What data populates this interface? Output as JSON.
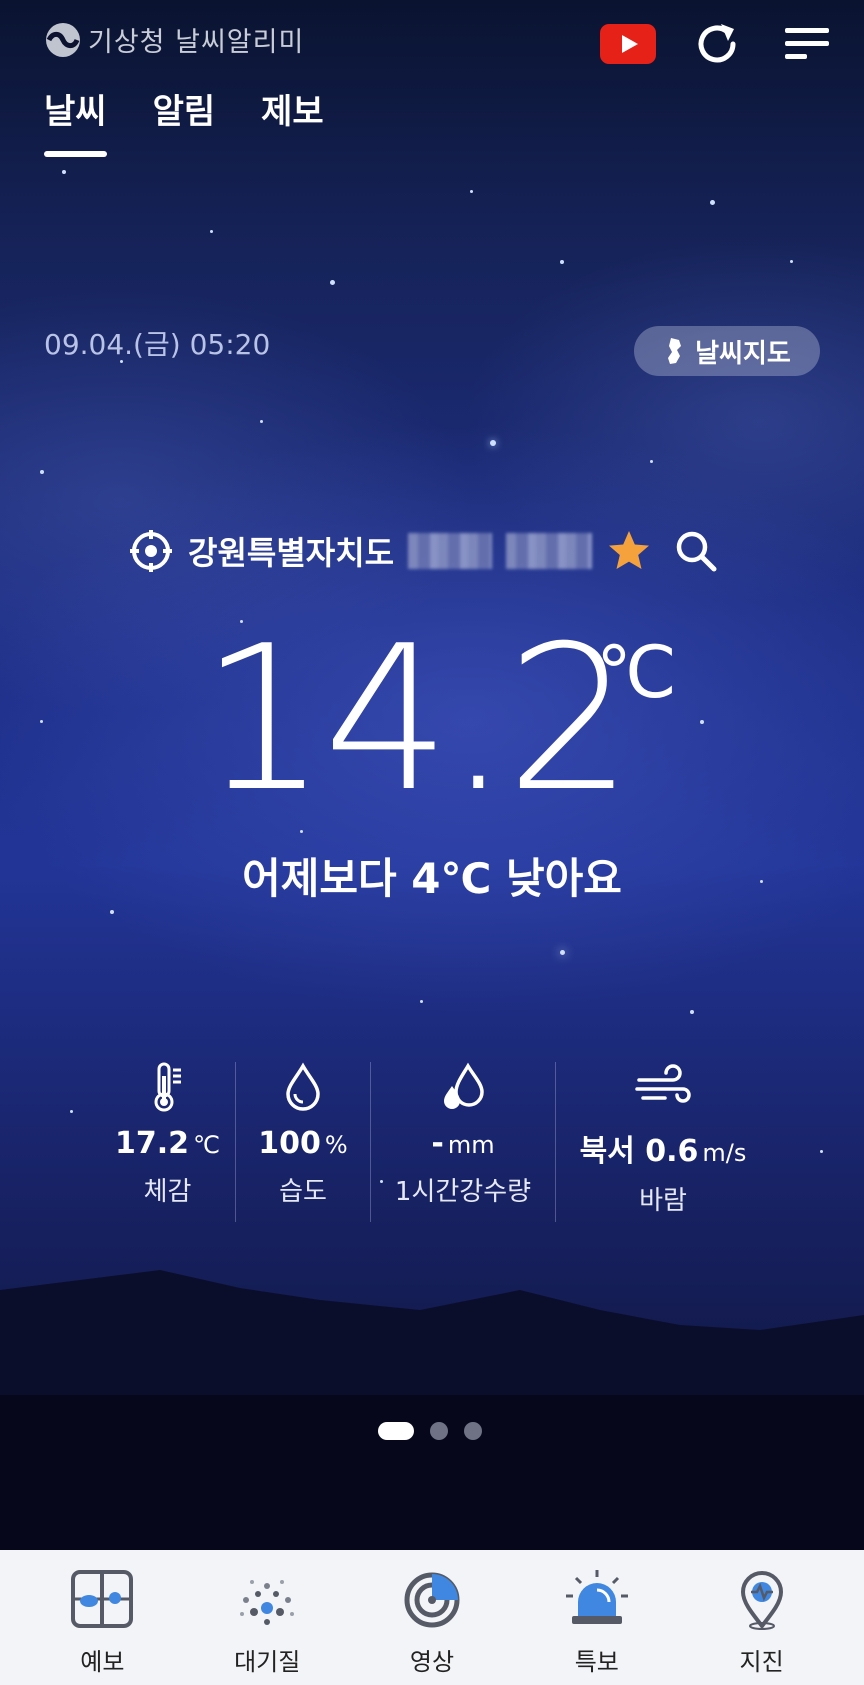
{
  "header": {
    "logo_text": "기상청 날씨알리미",
    "youtube_icon": "youtube-icon",
    "refresh_icon": "refresh-icon",
    "menu_icon": "hamburger-menu-icon"
  },
  "tabs": [
    {
      "label": "날씨",
      "active": true
    },
    {
      "label": "알림",
      "active": false
    },
    {
      "label": "제보",
      "active": false
    }
  ],
  "datetime": "09.04.(금) 05:20",
  "map_button": {
    "label": "날씨지도"
  },
  "location": {
    "name": "강원특별자치도",
    "favorite_color": "#f5a23c"
  },
  "current": {
    "temperature": "14.2",
    "unit": "℃",
    "compare_text": "어제보다 4℃ 낮아요"
  },
  "stats": [
    {
      "value": "17.2",
      "unit": "℃",
      "label": "체감",
      "icon": "thermometer-icon"
    },
    {
      "value": "100",
      "unit": "%",
      "label": "습도",
      "icon": "humidity-drop-icon"
    },
    {
      "value": "-",
      "unit": "mm",
      "label": "1시간강수량",
      "icon": "rain-drops-icon"
    },
    {
      "value": "북서 0.6",
      "unit": "m/s",
      "label": "바람",
      "icon": "wind-icon"
    }
  ],
  "pager": {
    "count": 3,
    "active": 1
  },
  "bottom_nav": [
    {
      "label": "예보",
      "icon": "forecast-icon"
    },
    {
      "label": "대기질",
      "icon": "air-quality-icon"
    },
    {
      "label": "영상",
      "icon": "radar-icon"
    },
    {
      "label": "특보",
      "icon": "alert-siren-icon"
    },
    {
      "label": "지진",
      "icon": "earthquake-pin-icon"
    }
  ],
  "colors": {
    "youtube": "#e62117",
    "accent_blue": "#2f8ff0",
    "star": "#f5a23c"
  }
}
